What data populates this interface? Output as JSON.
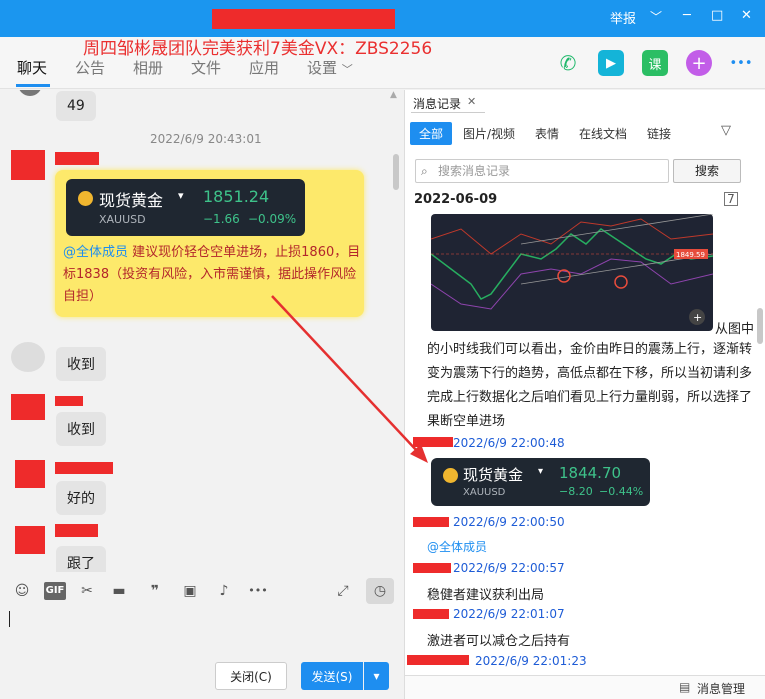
{
  "window": {
    "overlay_title": "周四邹彬晟团队完美获利7美金VX：ZBS2256",
    "controls": {
      "report": "举报",
      "chevron": "chevron-down-icon",
      "minimize": "─",
      "maximize": "□",
      "close": "✕"
    }
  },
  "tabs": [
    {
      "label": "聊天"
    },
    {
      "label": "公告"
    },
    {
      "label": "相册"
    },
    {
      "label": "文件"
    },
    {
      "label": "应用"
    },
    {
      "label": "设置"
    }
  ],
  "top_icons": {
    "phone": "phone-icon",
    "video": "video-icon",
    "class_label": "课",
    "add": "+",
    "more": "•••"
  },
  "chat": {
    "msg_49": "49",
    "timestamp": "2022/6/9 20:43:01",
    "gold_card": {
      "name": "现货黄金",
      "price": "1851.24",
      "symbol": "XAUUSD",
      "change": "−1.66",
      "change_pct": "−0.09%"
    },
    "mention": "@全体成员",
    "advice": "建议现价轻仓空单进场，止损1860，目标1838（投资有风险，入市需谨慎，据此操作风险自担）",
    "reply1": "收到",
    "reply2": "收到",
    "reply3": "好的",
    "reply4": "跟了"
  },
  "toolbar": {
    "emoji": "emoji-icon",
    "gif": "GIF",
    "scissors": "scissors-icon",
    "folder": "folder-icon",
    "quote": "quote-icon",
    "image": "image-icon",
    "bell": "bell-icon",
    "more": "•••",
    "expand": "expand-icon",
    "history": "history-icon"
  },
  "buttons": {
    "close": "关闭(C)",
    "send": "发送(S)",
    "send_dropdown": "▾"
  },
  "history": {
    "title": "消息记录",
    "close": "✕",
    "filters": [
      "全部",
      "图片/视频",
      "表情",
      "在线文档",
      "链接"
    ],
    "search_placeholder": "搜索消息记录",
    "search_btn": "搜索",
    "date": "2022-06-09",
    "analysis_start": "从图中",
    "analysis_rest": "的小时线我们可以看出，金价由昨日的震荡上行，逐渐转变为震荡下行的趋势，高低点都在下移，所以当初请利多完成上行数据化之后咱们看见上行力量削弱，所以选择了果断空单进场",
    "time1": "2022/6/9 22:00:48",
    "gold_card2": {
      "name": "现货黄金",
      "price": "1844.70",
      "symbol": "XAUUSD",
      "change": "−8.20",
      "change_pct": "−0.44%"
    },
    "time2": "2022/6/9 22:00:50",
    "mention2": "@全体成员",
    "time3": "2022/6/9 22:00:57",
    "text3": "稳健者建议获利出局",
    "time4": "2022/6/9 22:01:07",
    "text4": "激进者可以减仓之后持有",
    "time5": "2022/6/9 22:01:23",
    "chart_price_label": "1849.59",
    "manage": "消息管理"
  },
  "colors": {
    "accent": "#1e8ef0",
    "titlebar": "#1b96ef",
    "gain_green": "#3ec28a",
    "card_dark": "#1f2731",
    "highlight_yellow": "#fde96b",
    "redaction": "#ee2b2b"
  }
}
